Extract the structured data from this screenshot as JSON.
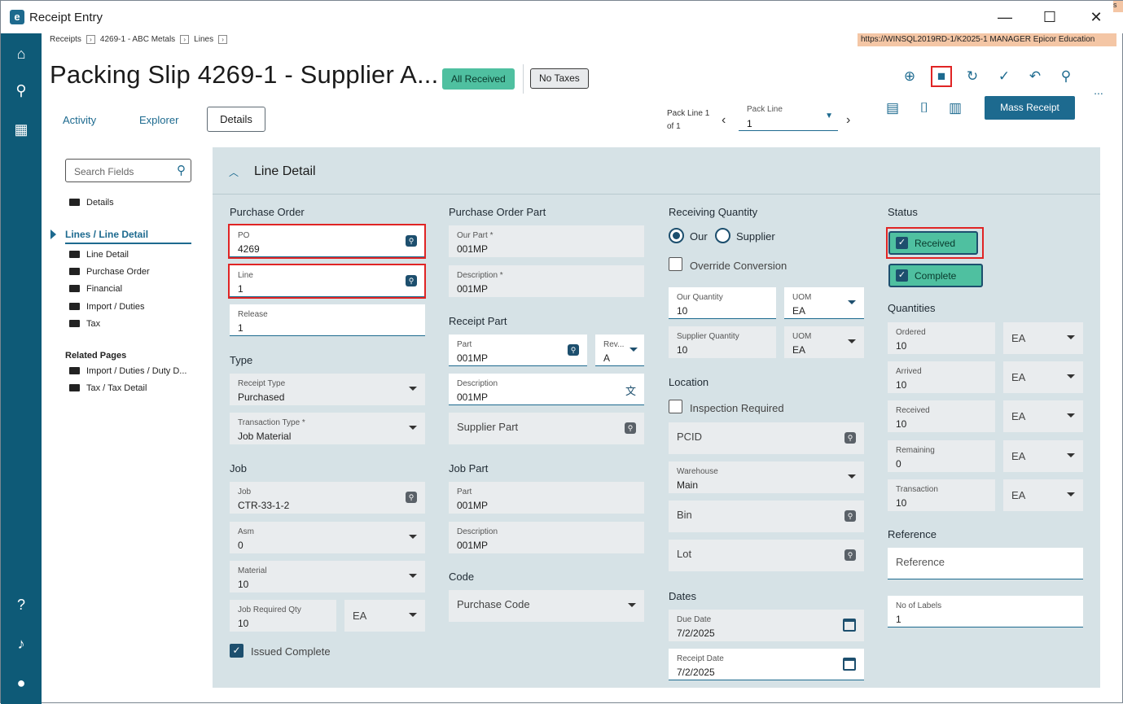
{
  "window": {
    "title": "Receipt Entry",
    "minimize": "—",
    "maximize": "☐",
    "close": "✕",
    "corner": "s"
  },
  "breadcrumbs": [
    "Receipts",
    "4269-1 - ABC Metals",
    "Lines"
  ],
  "server": "https://WINSQL2019RD-1/K2025-1   MANAGER   Epicor Education",
  "header": {
    "title": "Packing Slip 4269-1 - Supplier A...",
    "badge_received": "All Received",
    "badge_tax": "No Taxes"
  },
  "tabs": {
    "activity": "Activity",
    "explorer": "Explorer",
    "details": "Details"
  },
  "pack_nav": {
    "label_line1": "Pack Line 1",
    "label_line2": "of 1",
    "select_label": "Pack Line",
    "select_value": "1"
  },
  "toolbar": {
    "mass_receipt": "Mass Receipt",
    "more": "..."
  },
  "sidebar": {
    "search_placeholder": "Search Fields",
    "details": "Details",
    "active": "Lines / Line Detail",
    "items": [
      "Line Detail",
      "Purchase Order",
      "Financial",
      "Import / Duties",
      "Tax"
    ],
    "related_heading": "Related Pages",
    "related": [
      "Import / Duties / Duty D...",
      "Tax / Tax Detail"
    ]
  },
  "panel": {
    "title": "Line Detail"
  },
  "po": {
    "heading": "Purchase Order",
    "po_label": "PO",
    "po_value": "4269",
    "line_label": "Line",
    "line_value": "1",
    "release_label": "Release",
    "release_value": "1"
  },
  "type": {
    "heading": "Type",
    "receipt_type_label": "Receipt Type",
    "receipt_type_value": "Purchased",
    "trans_type_label": "Transaction Type *",
    "trans_type_value": "Job Material"
  },
  "job": {
    "heading": "Job",
    "job_label": "Job",
    "job_value": "CTR-33-1-2",
    "asm_label": "Asm",
    "asm_value": "0",
    "material_label": "Material",
    "material_value": "10",
    "req_qty_label": "Job Required Qty",
    "req_qty_value": "10",
    "req_uom": "EA",
    "issued_complete": "Issued Complete"
  },
  "po_part": {
    "heading": "Purchase Order Part",
    "our_part_label": "Our Part *",
    "our_part_value": "001MP",
    "desc_label": "Description *",
    "desc_value": "001MP"
  },
  "receipt_part": {
    "heading": "Receipt Part",
    "part_label": "Part",
    "part_value": "001MP",
    "rev_label": "Rev...",
    "rev_value": "A",
    "desc_label": "Description",
    "desc_value": "001MP",
    "supplier_part": "Supplier Part"
  },
  "job_part": {
    "heading": "Job Part",
    "part_label": "Part",
    "part_value": "001MP",
    "desc_label": "Description",
    "desc_value": "001MP"
  },
  "code": {
    "heading": "Code",
    "purchase_code": "Purchase Code"
  },
  "receiving": {
    "heading": "Receiving Quantity",
    "our": "Our",
    "supplier": "Supplier",
    "override": "Override Conversion",
    "our_qty_label": "Our Quantity",
    "our_qty_value": "10",
    "uom_label": "UOM",
    "our_uom": "EA",
    "sup_qty_label": "Supplier Quantity",
    "sup_qty_value": "10",
    "sup_uom": "EA"
  },
  "location": {
    "heading": "Location",
    "inspection": "Inspection Required",
    "pcid": "PCID",
    "warehouse_label": "Warehouse",
    "warehouse_value": "Main",
    "bin": "Bin",
    "lot": "Lot"
  },
  "dates": {
    "heading": "Dates",
    "due_label": "Due Date",
    "due_value": "7/2/2025",
    "receipt_label": "Receipt Date",
    "receipt_value": "7/2/2025"
  },
  "status": {
    "heading": "Status",
    "received": "Received",
    "complete": "Complete"
  },
  "quantities": {
    "heading": "Quantities",
    "rows": [
      {
        "label": "Ordered",
        "value": "10",
        "uom": "EA"
      },
      {
        "label": "Arrived",
        "value": "10",
        "uom": "EA"
      },
      {
        "label": "Received",
        "value": "10",
        "uom": "EA"
      },
      {
        "label": "Remaining",
        "value": "0",
        "uom": "EA"
      },
      {
        "label": "Transaction",
        "value": "10",
        "uom": "EA"
      }
    ]
  },
  "reference": {
    "heading": "Reference",
    "placeholder": "Reference",
    "labels_label": "No of Labels",
    "labels_value": "1"
  }
}
